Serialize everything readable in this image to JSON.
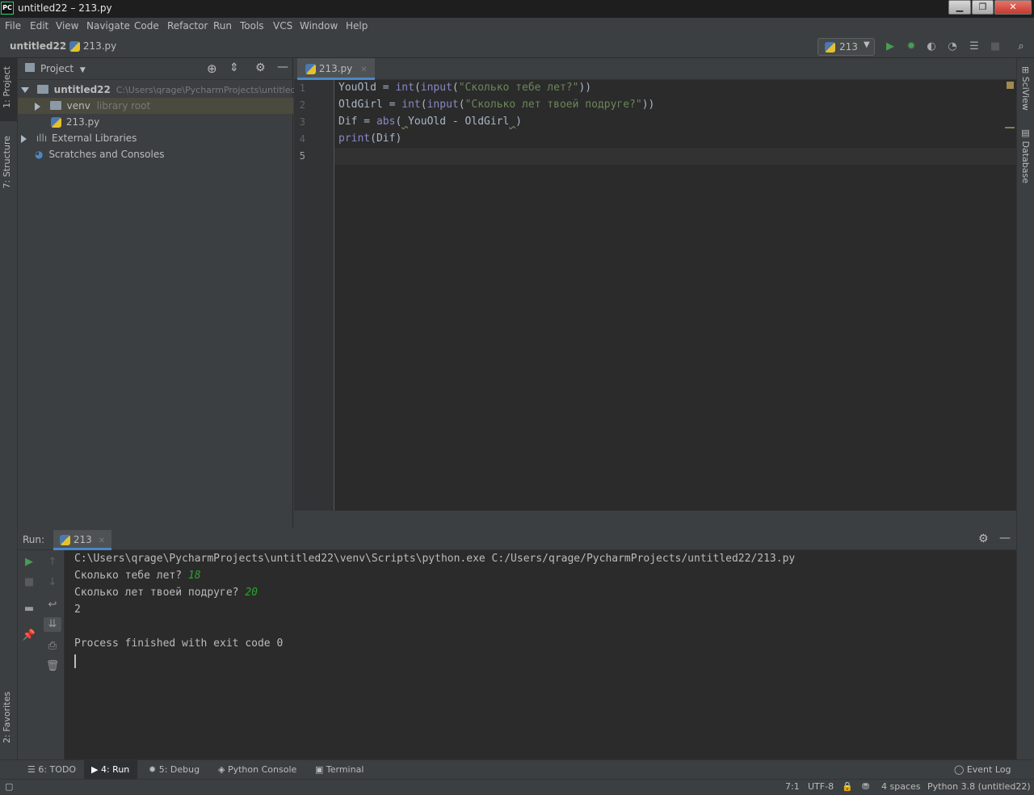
{
  "window": {
    "title": "untitled22 – 213.py",
    "app_icon_label": "PC",
    "minimize": "▁",
    "maximize": "❐",
    "close": "✕"
  },
  "menu": [
    "File",
    "Edit",
    "View",
    "Navigate",
    "Code",
    "Refactor",
    "Run",
    "Tools",
    "VCS",
    "Window",
    "Help"
  ],
  "navbar": {
    "project": "untitled22",
    "file": "213.py",
    "run_config": "213"
  },
  "left_stripe": {
    "project_tab": "1: Project",
    "structure_tab": "7: Structure",
    "favorites_tab": "2: Favorites"
  },
  "right_stripe": {
    "sciview_tab": "SciView",
    "database_tab": "Database"
  },
  "project_pane": {
    "title": "Project",
    "root_name": "untitled22",
    "root_path": "C:\\Users\\qrage\\PycharmProjects\\untitled22",
    "venv_name": "venv",
    "venv_hint": "library root",
    "file_name": "213.py",
    "external_libraries": "External Libraries",
    "scratches": "Scratches and Consoles"
  },
  "editor": {
    "tab_label": "213.py",
    "line_numbers": [
      "1",
      "2",
      "3",
      "4",
      "5"
    ]
  },
  "run_panel": {
    "label": "Run:",
    "tab": "213",
    "output": {
      "command": "C:\\Users\\qrage\\PycharmProjects\\untitled22\\venv\\Scripts\\python.exe C:/Users/qrage/PycharmProjects/untitled22/213.py",
      "prompt1": "Сколько тебе лет? ",
      "input1": "18",
      "prompt2": "Сколько лет твоей подруге? ",
      "input2": "20",
      "result": "2",
      "finished": "Process finished with exit code 0"
    }
  },
  "tool_windows": {
    "todo": "6: TODO",
    "run": "4: Run",
    "debug": "5: Debug",
    "python_console": "Python Console",
    "terminal": "Terminal",
    "event_log": "Event Log"
  },
  "status_bar": {
    "position": "7:1",
    "encoding": "UTF-8",
    "indent": "4 spaces",
    "interpreter": "Python 3.8 (untitled22)"
  },
  "colors": {
    "keyword_builtin": "#8888c6",
    "string": "#6a8759",
    "user_input": "#2ba32b",
    "run_green": "#499c54",
    "accent_tab": "#4a88c7"
  }
}
